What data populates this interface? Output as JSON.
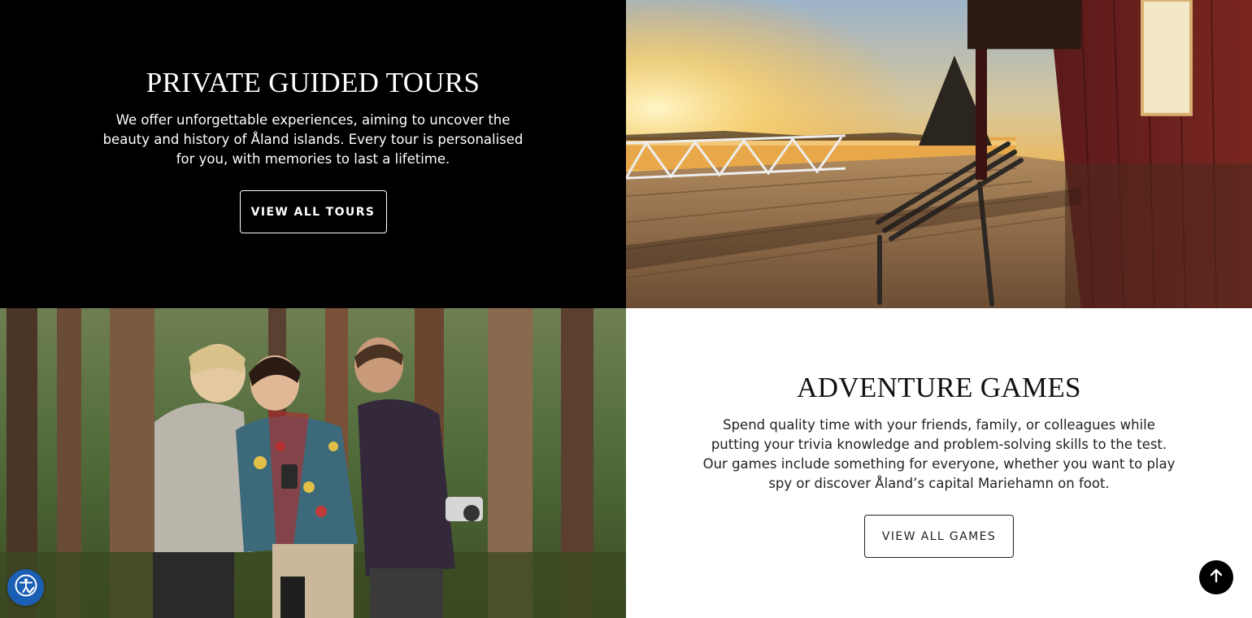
{
  "tours": {
    "heading": "PRIVATE GUIDED TOURS",
    "description": "We offer unforgettable experiences, aiming to uncover the beauty and history of Åland islands. Every tour is personalised for you, with memories to last a lifetime.",
    "button_label": "VIEW ALL TOURS"
  },
  "games": {
    "heading": "ADVENTURE GAMES",
    "description": "Spend quality time with your friends, family, or colleagues while putting your trivia knowledge and problem-solving skills to the test. Our games include something for everyone, whether you want to play spy or discover Åland’s capital Mariehamn on foot.",
    "button_label": "VIEW ALL GAMES"
  },
  "images": {
    "top_right": "sunset-deck-photo",
    "bottom_left": "forest-group-photo"
  },
  "widgets": {
    "accessibility_icon": "accessibility-icon",
    "back_to_top_icon": "arrow-up-icon"
  },
  "colors": {
    "dark_panel": "#000000",
    "light_panel": "#ffffff",
    "accessibility_blue": "#1a5fb4"
  }
}
